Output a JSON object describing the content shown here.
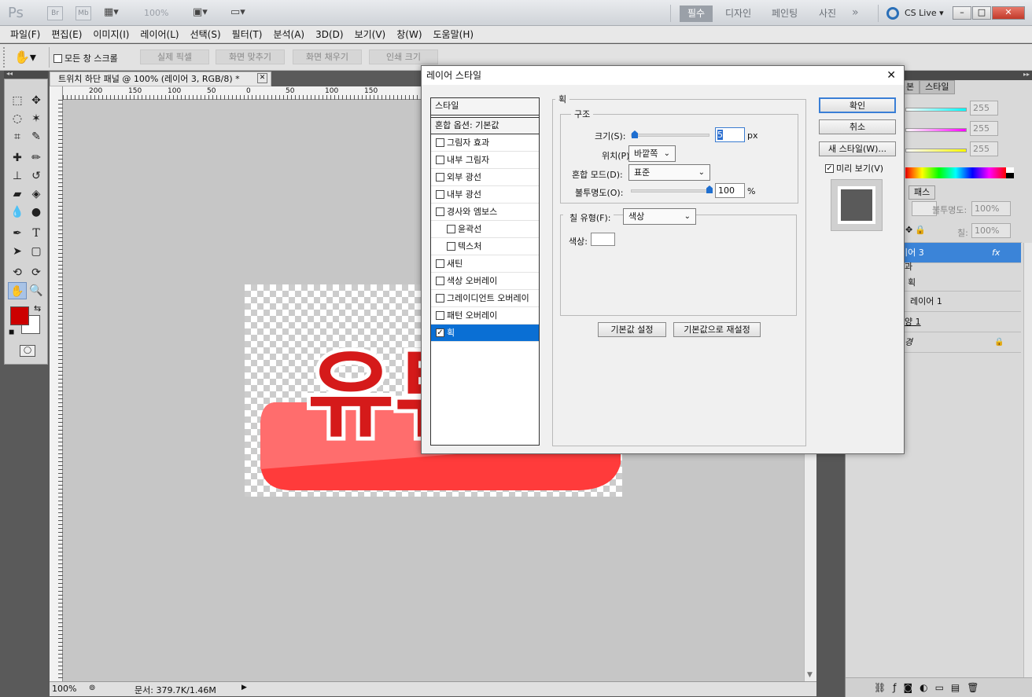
{
  "app": {
    "logo": "Ps",
    "bridge": "Br",
    "mini_bridge": "Mb",
    "zoom": "100%",
    "workspaces": [
      "필수",
      "디자인",
      "페인팅",
      "사진"
    ],
    "more": "»",
    "cslive": "CS Live",
    "window_buttons": [
      "–",
      "□",
      "✕"
    ]
  },
  "menu": [
    "파일(F)",
    "편집(E)",
    "이미지(I)",
    "레이어(L)",
    "선택(S)",
    "필터(T)",
    "분석(A)",
    "3D(D)",
    "보기(V)",
    "창(W)",
    "도움말(H)"
  ],
  "options": {
    "scroll_all": "모든 창 스크롤",
    "buttons": [
      "실제 픽셀",
      "화면 맞추기",
      "화면 채우기",
      "인쇄 크기"
    ]
  },
  "document": {
    "tab": "트위치 하단 패널 @ 100% (레이어 3, RGB/8) *",
    "ruler_labels": [
      "200",
      "150",
      "100",
      "50",
      "0",
      "50",
      "100",
      "150"
    ],
    "status_zoom": "100%",
    "status_doc": "문서: 379.7K/1.46M",
    "art_text": "유튜"
  },
  "panels": {
    "top_tabs": [
      "본",
      "스타일"
    ],
    "color_values": [
      "255",
      "255",
      "255"
    ],
    "layer_tabs": [
      "패스"
    ],
    "opacity_label": "불투명도:",
    "opacity_value": "100%",
    "fill_label": "칠:",
    "fill_value": "100%",
    "layers": [
      {
        "name": "이어 3",
        "fx": "fx",
        "selected": true
      },
      {
        "name": "과",
        "fx": "",
        "selected": false
      },
      {
        "name": "획",
        "fx": "",
        "selected": false
      },
      {
        "name": "레이어 1",
        "fx": "",
        "selected": false
      },
      {
        "name": "양 1",
        "fx": "",
        "selected": false
      },
      {
        "name": "경",
        "fx": "",
        "selected": false
      }
    ]
  },
  "dialog": {
    "title": "레이어 스타일",
    "close": "✕",
    "styles_header": "스타일",
    "blend_options": "혼합 옵션: 기본값",
    "items": [
      {
        "label": "그림자 효과",
        "checked": false,
        "sub": false
      },
      {
        "label": "내부 그림자",
        "checked": false,
        "sub": false
      },
      {
        "label": "외부 광선",
        "checked": false,
        "sub": false
      },
      {
        "label": "내부 광선",
        "checked": false,
        "sub": false
      },
      {
        "label": "경사와 엠보스",
        "checked": false,
        "sub": false
      },
      {
        "label": "윤곽선",
        "checked": false,
        "sub": true
      },
      {
        "label": "텍스처",
        "checked": false,
        "sub": true
      },
      {
        "label": "새틴",
        "checked": false,
        "sub": false
      },
      {
        "label": "색상 오버레이",
        "checked": false,
        "sub": false
      },
      {
        "label": "그레이디언트 오버레이",
        "checked": false,
        "sub": false
      },
      {
        "label": "패턴 오버레이",
        "checked": false,
        "sub": false
      },
      {
        "label": "획",
        "checked": true,
        "sub": false
      }
    ],
    "section_title": "획",
    "structure_title": "구조",
    "size_label": "크기(S):",
    "size_value": "5",
    "size_unit": "px",
    "size_level": 0.05,
    "position_label": "위치(P):",
    "position_value": "바깥쪽",
    "blend_label": "혼합 모드(D):",
    "blend_value": "표준",
    "opacity_label": "불투명도(O):",
    "opacity_value": "100",
    "opacity_unit": "%",
    "opacity_level": 1.0,
    "fill_type_label": "칠 유형(F):",
    "fill_type_value": "색상",
    "color_label": "색상:",
    "stroke_color": "#ffffff",
    "btn_make_default": "기본값 설정",
    "btn_reset_default": "기본값으로 재설정",
    "btn_ok": "확인",
    "btn_cancel": "취소",
    "btn_new_style": "새 스타일(W)...",
    "preview_label": "미리 보기(V)",
    "preview_checked": true
  },
  "colors": {
    "foreground": "#cc0000",
    "background": "#ffffff",
    "selection": "#0a6fd4",
    "canvas_bg": "#c6c6c6"
  }
}
